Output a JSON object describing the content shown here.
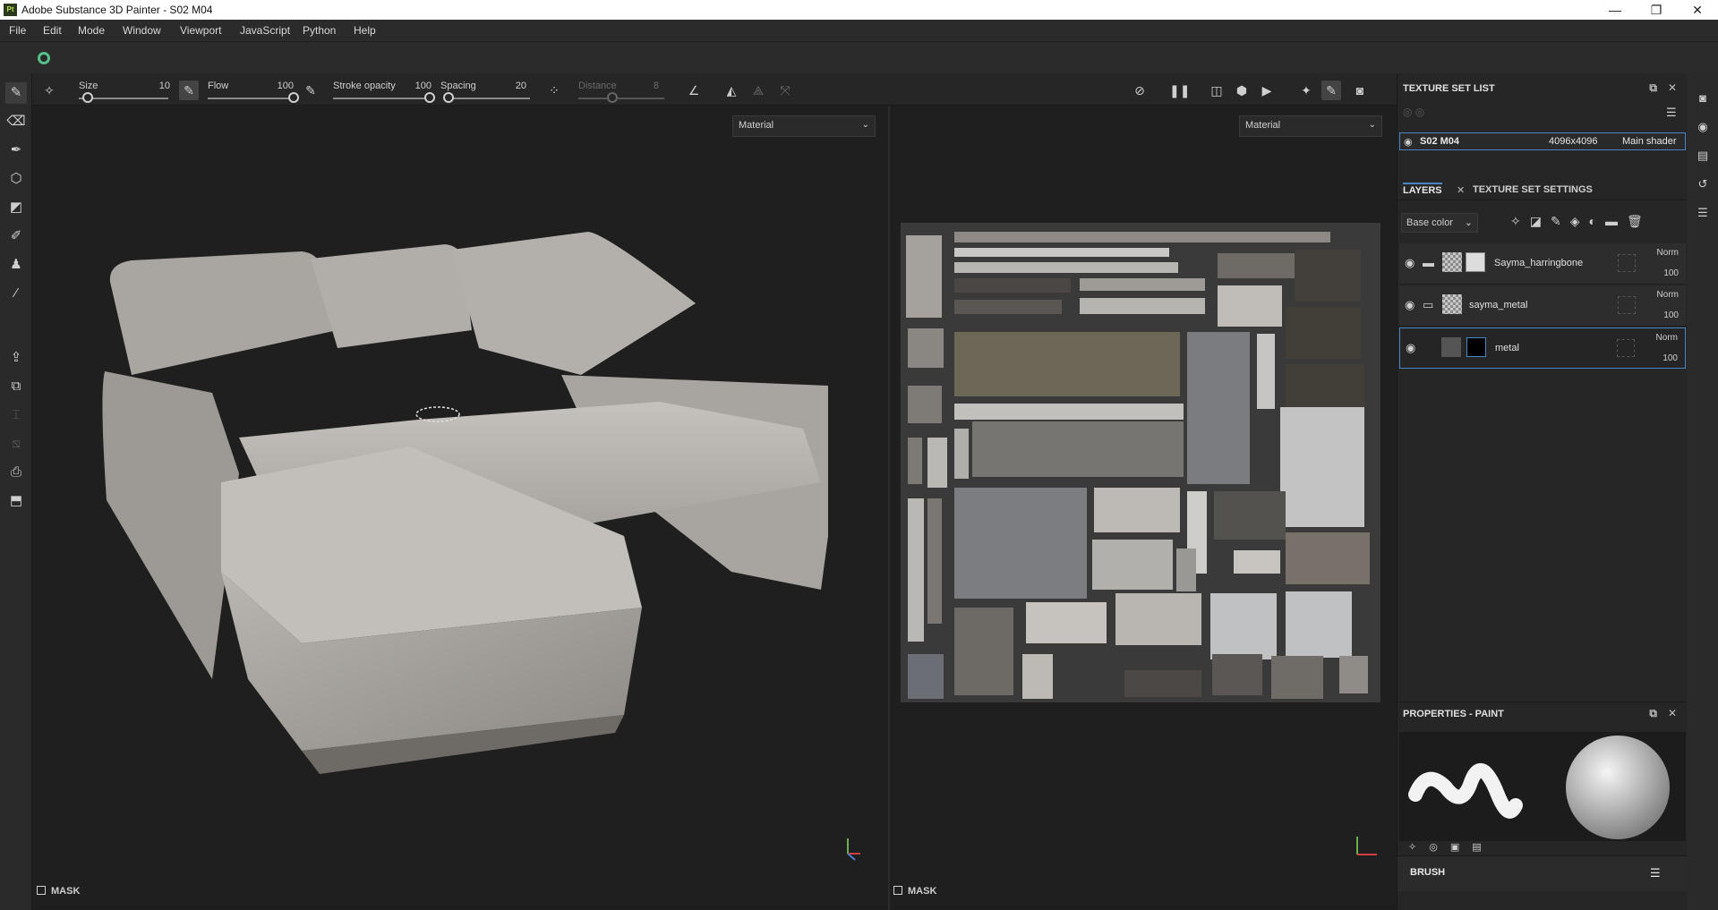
{
  "window": {
    "app_icon": "Pt",
    "title": "Adobe Substance 3D Painter - S02 M04",
    "controls": {
      "minimize": "—",
      "maximize": "❐",
      "close": "✕"
    }
  },
  "menu": [
    "File",
    "Edit",
    "Mode",
    "Window",
    "Viewport",
    "JavaScript",
    "Python",
    "Help"
  ],
  "tool_options": {
    "size_label": "Size",
    "size_value": "10",
    "size_level": 0.1,
    "flow_label": "Flow",
    "flow_value": "100",
    "flow_level": 1.0,
    "stroke_opacity_label": "Stroke opacity",
    "stroke_opacity_value": "100",
    "stroke_opacity_level": 1.0,
    "spacing_label": "Spacing",
    "spacing_value": "20",
    "spacing_level": 0.05,
    "distance_label": "Distance",
    "distance_value": "8",
    "distance_level": 0.4
  },
  "viewport3d": {
    "dropdown": "Material",
    "mask_label": "MASK"
  },
  "viewport2d": {
    "dropdown": "Material",
    "mask_label": "MASK"
  },
  "texture_set_list": {
    "title": "TEXTURE SET LIST",
    "item": {
      "name": "S02 M04",
      "resolution": "4096x4096",
      "shader": "Main shader"
    }
  },
  "layers_panel": {
    "tab_layers": "LAYERS",
    "tab_settings": "TEXTURE SET SETTINGS",
    "channel": "Base color",
    "layers": [
      {
        "name": "Sayma_harringbone",
        "blend": "Norm",
        "opacity": "100"
      },
      {
        "name": "sayma_metal",
        "blend": "Norm",
        "opacity": "100"
      },
      {
        "name": "metal",
        "blend": "Norm",
        "opacity": "100"
      }
    ]
  },
  "properties_panel": {
    "title": "PROPERTIES - PAINT",
    "brush_label": "BRUSH"
  },
  "colors": {
    "accent_blue": "#4a86c5",
    "logo_green": "#55c088"
  }
}
